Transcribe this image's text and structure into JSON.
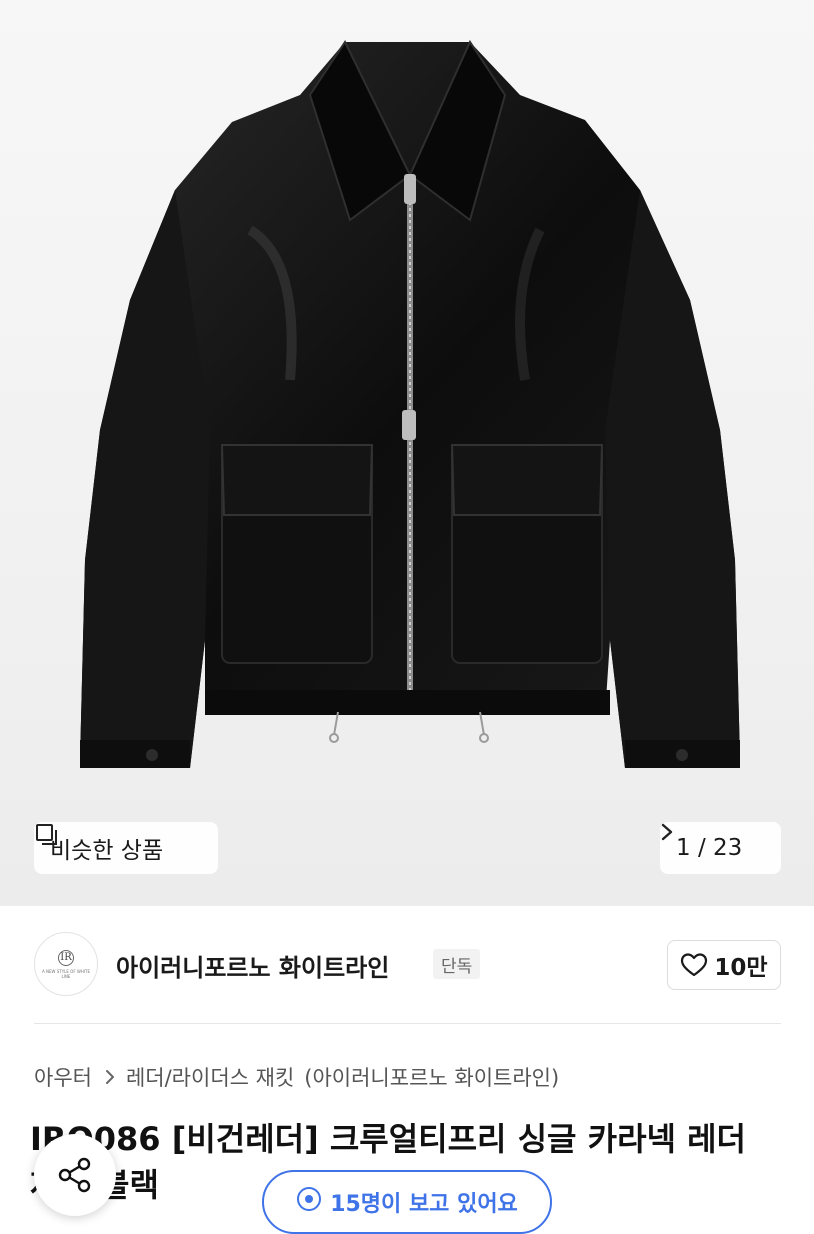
{
  "hero": {
    "image_alt": "black faux leather zip-up jacket",
    "similar_label": "비슷한 상품",
    "counter": "1 / 23"
  },
  "brand": {
    "logo_monogram": "IR",
    "logo_tagline": "A NEW STYLE OF WHITE LINE",
    "name": "아이러니포르노 화이트라인",
    "badge": "단독",
    "like_count": "10만"
  },
  "breadcrumb": {
    "category": "아우터",
    "subcategory": "레더/라이더스 재킷",
    "brand": "(아이러니포르노 화이트라인)"
  },
  "product": {
    "title": "IRO086 [비건레더] 크루얼티프리 싱글 카라넥 레더 재킷 블랙"
  },
  "viewers": {
    "text": "15명이 보고 있어요"
  },
  "colors": {
    "accent": "#3f73e8",
    "text": "#111111",
    "muted": "#555555"
  }
}
